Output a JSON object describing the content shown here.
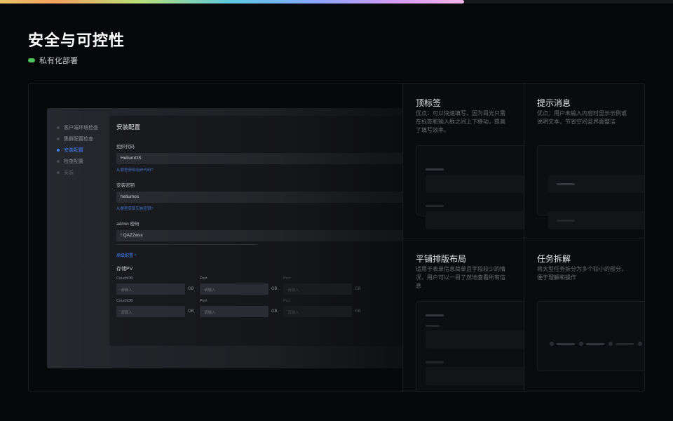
{
  "progress": {
    "value": 0.69,
    "colors": [
      "#e9c46a",
      "#b9e07a",
      "#5ec8e0",
      "#8aa6ff",
      "#d49cf5",
      "#f2b6e8"
    ]
  },
  "header": {
    "title": "安全与可控性",
    "subtitle": "私有化部署",
    "pill_color": "#4ec25d"
  },
  "mock": {
    "nav": [
      {
        "label": "客户端环境检查",
        "state": "normal"
      },
      {
        "label": "集群配置检查",
        "state": "normal"
      },
      {
        "label": "安装配置",
        "state": "active"
      },
      {
        "label": "检查配置",
        "state": "normal"
      },
      {
        "label": "安装",
        "state": "dim"
      }
    ],
    "panel": {
      "title": "安装配置",
      "org_label": "组织代码",
      "org_value": "HeliumOS",
      "org_link": "从哪里获取组织代码?",
      "key_label": "安装密钥",
      "key_value": "heliumos",
      "key_link": "从哪里获取安装密钥?",
      "admin_label": "admin 密码",
      "admin_value": "! QAZ2wsx",
      "advanced_link": "高级配置 ^",
      "storage_title": "存储PV",
      "storage_rows": [
        [
          {
            "label": "CouchDB",
            "placeholder": "请输入",
            "unit": "GB"
          },
          {
            "label": "Perr",
            "placeholder": "请输入",
            "unit": "GB"
          },
          {
            "label": "Perr",
            "placeholder": "请输入",
            "unit": "GB"
          }
        ],
        [
          {
            "label": "CouchDB",
            "placeholder": "请输入",
            "unit": "GB"
          },
          {
            "label": "Perr",
            "placeholder": "请输入",
            "unit": "GB"
          },
          {
            "label": "Perr",
            "placeholder": "请输入",
            "unit": "GB"
          }
        ]
      ]
    }
  },
  "cards": [
    {
      "title": "顶标签",
      "desc": "优点：可以快速填写，因为目光只需在标签和输入框之间上下移动，提高了填写效率。"
    },
    {
      "title": "提示消息",
      "desc": "优点：用户未输入内容时显示示例或说明文本，节省空间且界面整洁"
    },
    {
      "title": "平铺排版布局",
      "desc": "适用于表单信息简单且字段较少的情况，用户可以一目了然地查看所有信息"
    },
    {
      "title": "任务拆解",
      "desc": "将大型任务拆分为多个较小的部分，便于理解和操作"
    }
  ]
}
